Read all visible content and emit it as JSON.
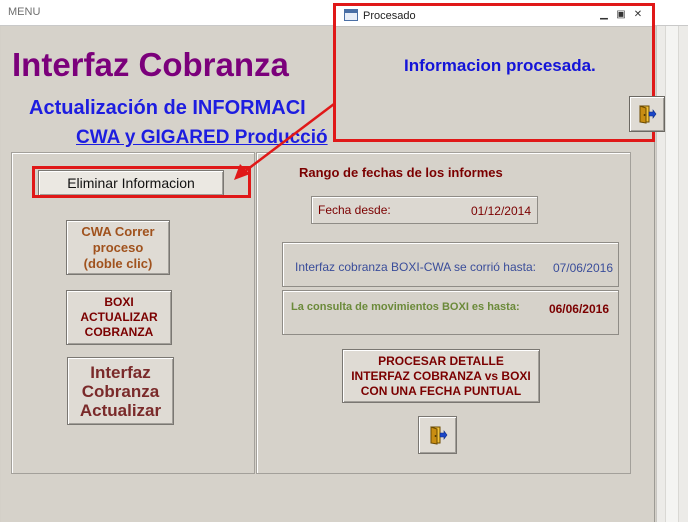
{
  "window": {
    "title": "MENU"
  },
  "header": {
    "title": "Interfaz Cobranza",
    "subtitle1": "Actualización de INFORMACI",
    "subtitle2": "CWA y GIGARED Producció"
  },
  "left_panel": {
    "eliminar_label": "Eliminar Informacion",
    "cwa_button": [
      "CWA Correr",
      "proceso",
      "(doble clic)"
    ],
    "boxi_button": [
      "BOXI",
      "ACTUALIZAR",
      "COBRANZA"
    ],
    "interfaz_button": [
      "Interfaz",
      "Cobranza",
      "Actualizar"
    ]
  },
  "right_panel": {
    "range_label": "Rango de fechas de los informes",
    "fecha_desde_label": "Fecha desde:",
    "fecha_desde_value": "01/12/2014",
    "cwa_label": "Interfaz cobranza BOXI-CWA se corrió hasta:",
    "cwa_value": "07/06/2016",
    "boxi_label": "La consulta de movimientos BOXI es hasta:",
    "boxi_value": "06/06/2016",
    "procesar_button": [
      "PROCESAR DETALLE",
      "INTERFAZ COBRANZA vs BOXI",
      "CON UNA FECHA PUNTUAL"
    ]
  },
  "popup": {
    "title": "Procesado",
    "message": "Informacion procesada."
  },
  "colors": {
    "title_purple": "#7b007b",
    "heading_blue": "#1d1de0",
    "dark_red": "#7b0000",
    "highlight_red": "#e01818",
    "message_blue": "#1414d8"
  },
  "icons": {
    "exit": "door-exit-icon",
    "form": "form-window-icon"
  }
}
